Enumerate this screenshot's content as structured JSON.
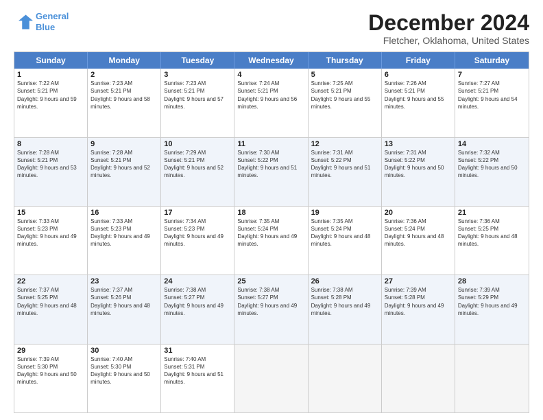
{
  "header": {
    "logo": {
      "line1": "General",
      "line2": "Blue"
    },
    "title": "December 2024",
    "subtitle": "Fletcher, Oklahoma, United States"
  },
  "calendar": {
    "days": [
      "Sunday",
      "Monday",
      "Tuesday",
      "Wednesday",
      "Thursday",
      "Friday",
      "Saturday"
    ],
    "weeks": [
      [
        {
          "day": "1",
          "sunrise": "7:22 AM",
          "sunset": "5:21 PM",
          "daylight": "9 hours and 59 minutes."
        },
        {
          "day": "2",
          "sunrise": "7:23 AM",
          "sunset": "5:21 PM",
          "daylight": "9 hours and 58 minutes."
        },
        {
          "day": "3",
          "sunrise": "7:23 AM",
          "sunset": "5:21 PM",
          "daylight": "9 hours and 57 minutes."
        },
        {
          "day": "4",
          "sunrise": "7:24 AM",
          "sunset": "5:21 PM",
          "daylight": "9 hours and 56 minutes."
        },
        {
          "day": "5",
          "sunrise": "7:25 AM",
          "sunset": "5:21 PM",
          "daylight": "9 hours and 55 minutes."
        },
        {
          "day": "6",
          "sunrise": "7:26 AM",
          "sunset": "5:21 PM",
          "daylight": "9 hours and 55 minutes."
        },
        {
          "day": "7",
          "sunrise": "7:27 AM",
          "sunset": "5:21 PM",
          "daylight": "9 hours and 54 minutes."
        }
      ],
      [
        {
          "day": "8",
          "sunrise": "7:28 AM",
          "sunset": "5:21 PM",
          "daylight": "9 hours and 53 minutes."
        },
        {
          "day": "9",
          "sunrise": "7:28 AM",
          "sunset": "5:21 PM",
          "daylight": "9 hours and 52 minutes."
        },
        {
          "day": "10",
          "sunrise": "7:29 AM",
          "sunset": "5:21 PM",
          "daylight": "9 hours and 52 minutes."
        },
        {
          "day": "11",
          "sunrise": "7:30 AM",
          "sunset": "5:22 PM",
          "daylight": "9 hours and 51 minutes."
        },
        {
          "day": "12",
          "sunrise": "7:31 AM",
          "sunset": "5:22 PM",
          "daylight": "9 hours and 51 minutes."
        },
        {
          "day": "13",
          "sunrise": "7:31 AM",
          "sunset": "5:22 PM",
          "daylight": "9 hours and 50 minutes."
        },
        {
          "day": "14",
          "sunrise": "7:32 AM",
          "sunset": "5:22 PM",
          "daylight": "9 hours and 50 minutes."
        }
      ],
      [
        {
          "day": "15",
          "sunrise": "7:33 AM",
          "sunset": "5:23 PM",
          "daylight": "9 hours and 49 minutes."
        },
        {
          "day": "16",
          "sunrise": "7:33 AM",
          "sunset": "5:23 PM",
          "daylight": "9 hours and 49 minutes."
        },
        {
          "day": "17",
          "sunrise": "7:34 AM",
          "sunset": "5:23 PM",
          "daylight": "9 hours and 49 minutes."
        },
        {
          "day": "18",
          "sunrise": "7:35 AM",
          "sunset": "5:24 PM",
          "daylight": "9 hours and 49 minutes."
        },
        {
          "day": "19",
          "sunrise": "7:35 AM",
          "sunset": "5:24 PM",
          "daylight": "9 hours and 48 minutes."
        },
        {
          "day": "20",
          "sunrise": "7:36 AM",
          "sunset": "5:24 PM",
          "daylight": "9 hours and 48 minutes."
        },
        {
          "day": "21",
          "sunrise": "7:36 AM",
          "sunset": "5:25 PM",
          "daylight": "9 hours and 48 minutes."
        }
      ],
      [
        {
          "day": "22",
          "sunrise": "7:37 AM",
          "sunset": "5:25 PM",
          "daylight": "9 hours and 48 minutes."
        },
        {
          "day": "23",
          "sunrise": "7:37 AM",
          "sunset": "5:26 PM",
          "daylight": "9 hours and 48 minutes."
        },
        {
          "day": "24",
          "sunrise": "7:38 AM",
          "sunset": "5:27 PM",
          "daylight": "9 hours and 49 minutes."
        },
        {
          "day": "25",
          "sunrise": "7:38 AM",
          "sunset": "5:27 PM",
          "daylight": "9 hours and 49 minutes."
        },
        {
          "day": "26",
          "sunrise": "7:38 AM",
          "sunset": "5:28 PM",
          "daylight": "9 hours and 49 minutes."
        },
        {
          "day": "27",
          "sunrise": "7:39 AM",
          "sunset": "5:28 PM",
          "daylight": "9 hours and 49 minutes."
        },
        {
          "day": "28",
          "sunrise": "7:39 AM",
          "sunset": "5:29 PM",
          "daylight": "9 hours and 49 minutes."
        }
      ],
      [
        {
          "day": "29",
          "sunrise": "7:39 AM",
          "sunset": "5:30 PM",
          "daylight": "9 hours and 50 minutes."
        },
        {
          "day": "30",
          "sunrise": "7:40 AM",
          "sunset": "5:30 PM",
          "daylight": "9 hours and 50 minutes."
        },
        {
          "day": "31",
          "sunrise": "7:40 AM",
          "sunset": "5:31 PM",
          "daylight": "9 hours and 51 minutes."
        },
        null,
        null,
        null,
        null
      ]
    ]
  }
}
